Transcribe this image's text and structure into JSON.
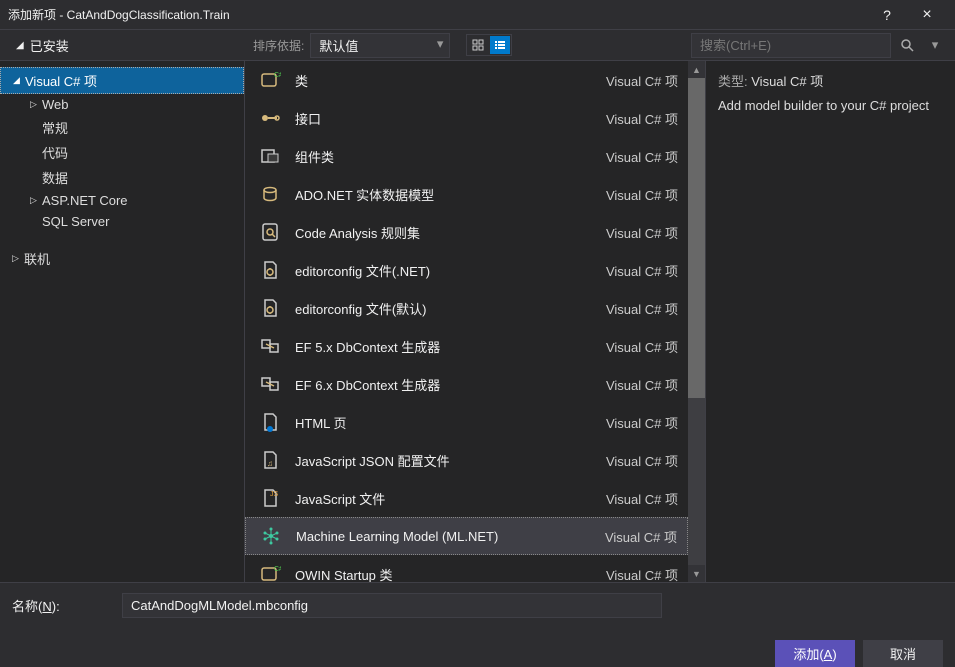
{
  "titlebar": {
    "title": "添加新项 - CatAndDogClassification.Train",
    "help": "?",
    "close": "×"
  },
  "toolbar": {
    "sidebar_header": "已安装",
    "sort_label": "排序依据:",
    "sort_value": "默认值",
    "search_placeholder": "搜索(Ctrl+E)"
  },
  "sidebar": {
    "items": [
      {
        "label": "Visual C# 项",
        "level": 0,
        "expanded": true,
        "selected": true
      },
      {
        "label": "Web",
        "level": 1,
        "expanded": false
      },
      {
        "label": "常规",
        "level": 1
      },
      {
        "label": "代码",
        "level": 1
      },
      {
        "label": "数据",
        "level": 1
      },
      {
        "label": "ASP.NET Core",
        "level": 1,
        "expanded": false
      },
      {
        "label": "SQL Server",
        "level": 1
      },
      {
        "label": "联机",
        "level": 0,
        "expanded": false
      }
    ]
  },
  "items": [
    {
      "name": "类",
      "lang": "Visual C# 项"
    },
    {
      "name": "接口",
      "lang": "Visual C# 项"
    },
    {
      "name": "组件类",
      "lang": "Visual C# 项"
    },
    {
      "name": "ADO.NET 实体数据模型",
      "lang": "Visual C# 项"
    },
    {
      "name": "Code Analysis 规则集",
      "lang": "Visual C# 项"
    },
    {
      "name": "editorconfig 文件(.NET)",
      "lang": "Visual C# 项"
    },
    {
      "name": "editorconfig 文件(默认)",
      "lang": "Visual C# 项"
    },
    {
      "name": "EF 5.x DbContext 生成器",
      "lang": "Visual C# 项"
    },
    {
      "name": "EF 6.x DbContext 生成器",
      "lang": "Visual C# 项"
    },
    {
      "name": "HTML 页",
      "lang": "Visual C# 项"
    },
    {
      "name": "JavaScript JSON 配置文件",
      "lang": "Visual C# 项"
    },
    {
      "name": "JavaScript 文件",
      "lang": "Visual C# 项"
    },
    {
      "name": "Machine Learning Model (ML.NET)",
      "lang": "Visual C# 项",
      "selected": true
    },
    {
      "name": "OWIN Startup 类",
      "lang": "Visual C# 项"
    }
  ],
  "rightpane": {
    "type_label": "类型:",
    "type_value": "Visual C# 项",
    "description": "Add model builder to your C# project"
  },
  "footer": {
    "name_label": "名称(N):",
    "name_value": "CatAndDogMLModel.mbconfig",
    "add_label": "添加(A)",
    "cancel_label": "取消"
  }
}
